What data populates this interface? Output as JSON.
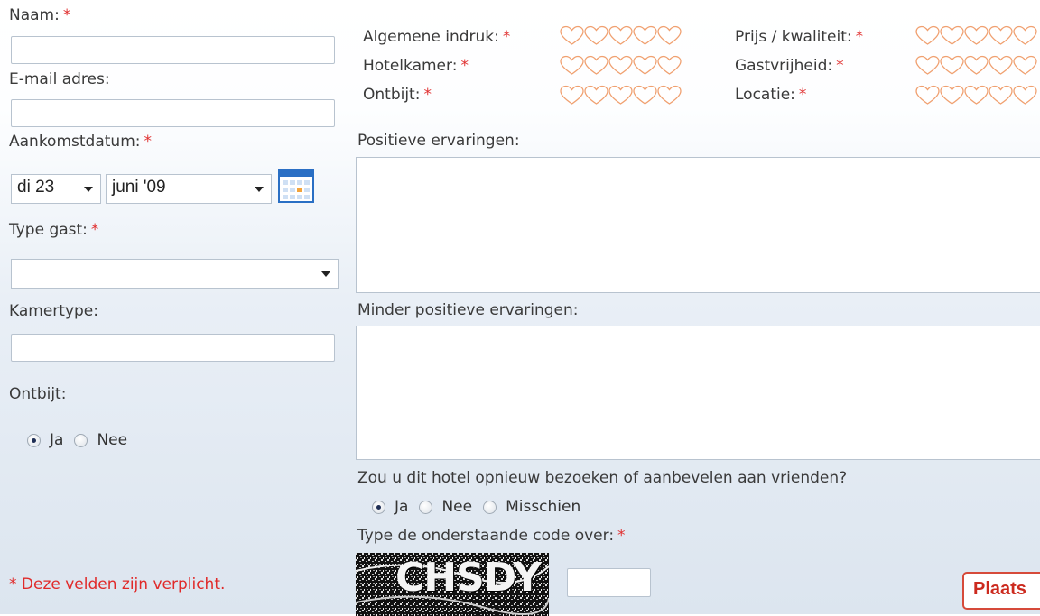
{
  "form": {
    "naam_label": "Naam:",
    "email_label": "E-mail adres:",
    "aankomst_label": "Aankomstdatum:",
    "day_value": "di 23",
    "month_value": "juni '09",
    "typegast_label": "Type gast:",
    "typegast_value": "",
    "kamertype_label": "Kamertype:",
    "ontbijt_label": "Ontbijt:",
    "ontbijt_options": [
      "Ja",
      "Nee"
    ],
    "ontbijt_selected": "Ja",
    "required_star": "*",
    "required_note": "* Deze velden zijn verplicht."
  },
  "ratings": {
    "algemene_indruk": "Algemene indruk:",
    "hotelkamer": "Hotelkamer:",
    "ontbijt": "Ontbijt:",
    "prijs_kwaliteit": "Prijs / kwaliteit:",
    "gastvrijheid": "Gastvrijheid:",
    "locatie": "Locatie:",
    "max_hearts": 5,
    "filled_hearts": 0,
    "heart_color": "#f0a070"
  },
  "reviews": {
    "positief_label": "Positieve ervaringen:",
    "minder_label": "Minder positieve ervaringen:",
    "aanbevelen_question": "Zou u dit hotel opnieuw bezoeken of aanbevelen aan vrienden?",
    "aanbevelen_options": [
      "Ja",
      "Nee",
      "Misschien"
    ],
    "aanbevelen_selected": "Ja",
    "captcha_label": "Type de onderstaande code over:",
    "captcha_text": "CHSDY",
    "captcha_value": ""
  },
  "submit_label": "Plaats"
}
